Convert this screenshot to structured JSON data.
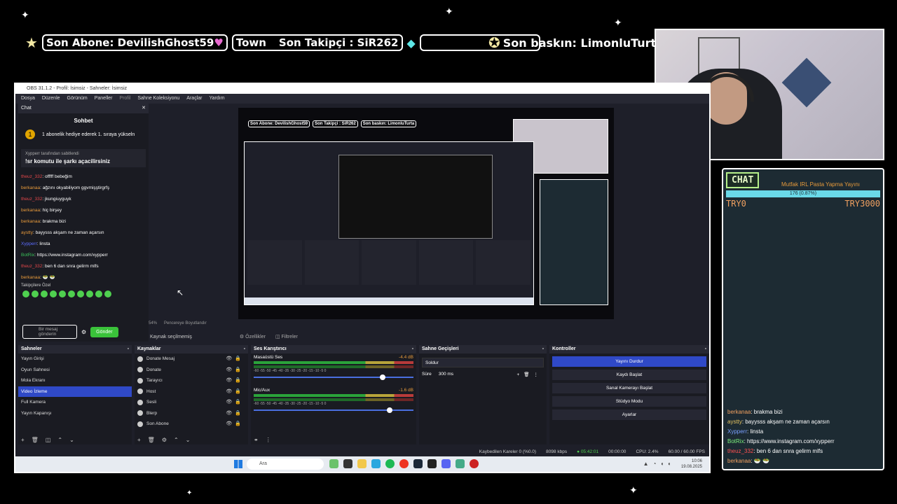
{
  "ticker": {
    "son_abone": "Son Abone: DevilishGhost59",
    "town": "Town",
    "son_takipci": "Son Takipçi : SiR262",
    "son_baskin": "Son baskın: LimonluTurta"
  },
  "chat_overlay": {
    "header": "CHAT",
    "goal_title": "Mutfak IRL Pasta Yapma Yayını",
    "goal_progress": "176 (0.87%)",
    "goal_min": "TRY0",
    "goal_max": "TRY3000",
    "messages": [
      {
        "user": "berkanaa",
        "text": ": brakma bizi"
      },
      {
        "user": "aystty",
        "text": ": bayysss akşam ne zaman açarsın"
      },
      {
        "user": "Xypperr",
        "text": ": linsta"
      },
      {
        "user": "BotRix",
        "text": ": https://www.instagram.com/xypperr"
      },
      {
        "user": "theuz_332",
        "text": ": ben 6 dan snra gelirm mlfs"
      },
      {
        "user": "berkanaa",
        "text": ": 🥗 🥗"
      }
    ]
  },
  "obs": {
    "title": "OBS 31.1.2 - Profil: İsimsiz - Sahneler: İsimsiz",
    "menu": [
      "Dosya",
      "Düzenle",
      "Görünüm",
      "Paneller",
      "Profil",
      "Sahne Koleksiyonu",
      "Araçlar",
      "Yardım"
    ],
    "chat_dock": {
      "label": "Chat",
      "title": "Sohbet",
      "gift_count": "1",
      "gift_text": "1 abonelik hediye ederek 1. sıraya yükseln",
      "pinned_by": "Xypperr tarafından sabitlendi",
      "pinned_msg": "!sr komutu ile şarkı açacilirsiniz",
      "lines": [
        {
          "user": "theuz_332",
          "text": ": offfff bebeğim"
        },
        {
          "user": "berkanaa",
          "text": ": ağzını okyabiliyom ggvmişştirgrfş"
        },
        {
          "user": "theuz_332",
          "text": ": jkungiuyguyk"
        },
        {
          "user": "berkanaa",
          "text": ": hiç birşey"
        },
        {
          "user": "berkanaa",
          "text": ": brakma bizi"
        },
        {
          "user": "aystty",
          "text": ": bayysss akşam ne zaman açarsın"
        },
        {
          "user": "Xypperr",
          "text": ": linsta"
        },
        {
          "user": "BotRix",
          "text": ": https://www.instagram.com/xypperr"
        },
        {
          "user": "theuz_332",
          "text": ": ben 6 dan snra gelirm mlfs"
        },
        {
          "user": "berkanaa",
          "text": ": 🥗 🥗"
        }
      ],
      "followers_only": "Takipçilere Özel",
      "input_placeholder": "Bir mesaj gönderin",
      "send": "Gönder"
    },
    "preview_zoom": "54%",
    "preview_fit": "Pencereye Boyutlandır",
    "source_tab": "Kaynak seçilmemiş",
    "properties": "Özellikler",
    "filters": "Filtreler",
    "scenes": {
      "title": "Sahneler",
      "items": [
        "Yayın Girişi",
        "Oyun Sahnesi",
        "Mola Ekranı",
        "Video İzleme",
        "Full Kamera",
        "Yayın Kapanışı"
      ],
      "selected": 3
    },
    "sources": {
      "title": "Kaynaklar",
      "items": [
        "Donate Mesaj",
        "Donate",
        "Tarayıcı",
        "Host",
        "Sesli",
        "Blerp",
        "Son Abone"
      ]
    },
    "mixer": {
      "title": "Ses Karıştırıcı",
      "channels": [
        {
          "name": "Masaüstü Ses",
          "db": "-4.4 dB"
        },
        {
          "name": "Mic/Aux",
          "db": "-1.6 dB"
        }
      ],
      "ticks": "-60  -55  -50  -45  -40  -35  -30  -25  -20  -15  -10  -5  0"
    },
    "transitions": {
      "title": "Sahne Geçişleri",
      "selected": "Soldur",
      "duration_label": "Süre",
      "duration": "300 ms"
    },
    "controls": {
      "title": "Kontroller",
      "buttons": [
        "Yayını Durdur",
        "Kaydı Başlat",
        "Sanal Kamerayı Başlat",
        "Stüdyo Modu",
        "Ayarlar"
      ]
    },
    "status": {
      "dropped": "Kaybedilen Kareler 0 (%0.0)",
      "bitrate": "8098 kbps",
      "live_time": "05:42:01",
      "rec_time": "00:00:00",
      "cpu": "CPU: 2.4%",
      "fps": "60.00 / 60.00 FPS"
    },
    "taskbar": {
      "search": "Ara",
      "time": "10:06",
      "date": "19.08.2025"
    }
  }
}
